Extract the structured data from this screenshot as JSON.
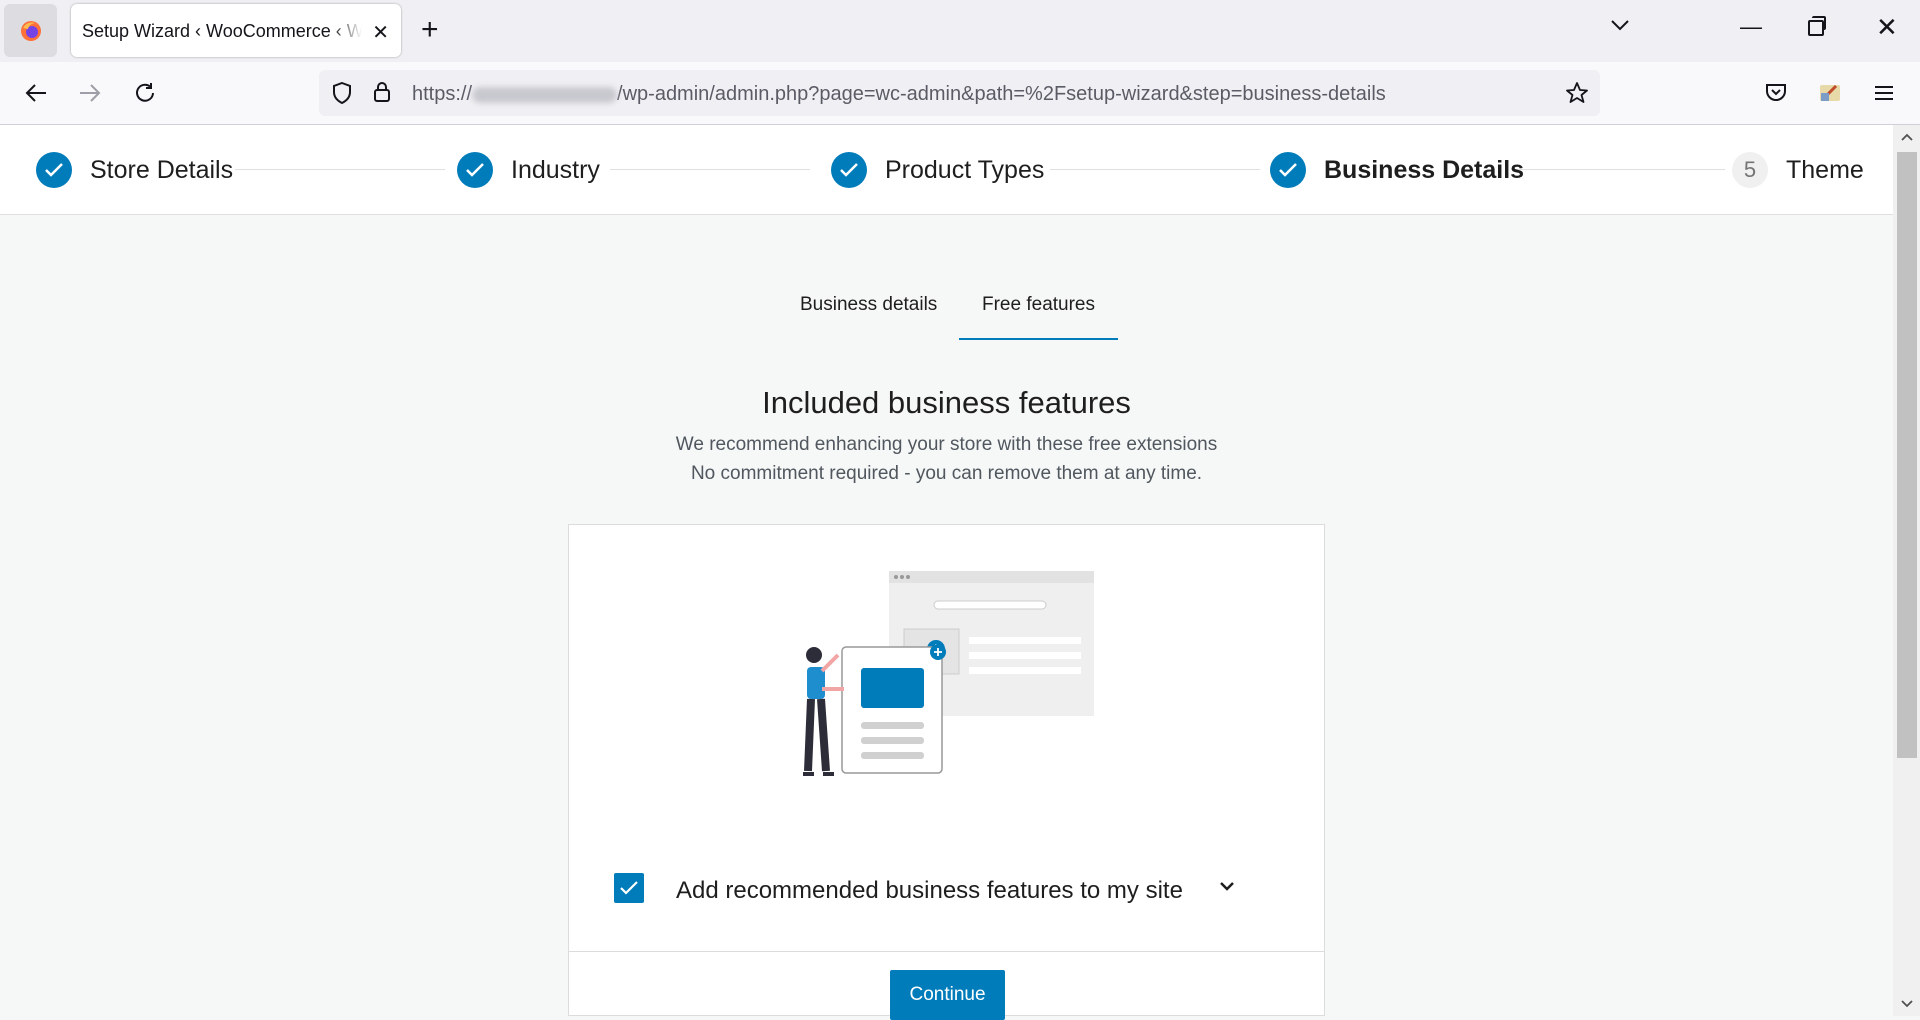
{
  "browser": {
    "tab_title": "Setup Wizard ‹ WooCommerce ‹ WordPress",
    "url_prefix": "https://",
    "url_suffix": "/wp-admin/admin.php?page=wc-admin&path=%2Fsetup-wizard&step=business-details"
  },
  "stepper": {
    "steps": [
      {
        "label": "Store Details",
        "state": "complete"
      },
      {
        "label": "Industry",
        "state": "complete"
      },
      {
        "label": "Product Types",
        "state": "complete"
      },
      {
        "label": "Business Details",
        "state": "active"
      },
      {
        "label": "Theme",
        "state": "pending",
        "number": "5"
      }
    ]
  },
  "subtabs": {
    "business_details": "Business details",
    "free_features": "Free features",
    "selected": "Free features"
  },
  "main": {
    "heading": "Included business features",
    "subtitle_line1": "We recommend enhancing your store with these free extensions",
    "subtitle_line2": "No commitment required - you can remove them at any time.",
    "checkbox_label": "Add recommended business features to my site",
    "checkbox_checked": true,
    "continue_label": "Continue"
  },
  "colors": {
    "accent": "#007cba",
    "background": "#f6f7f7"
  }
}
